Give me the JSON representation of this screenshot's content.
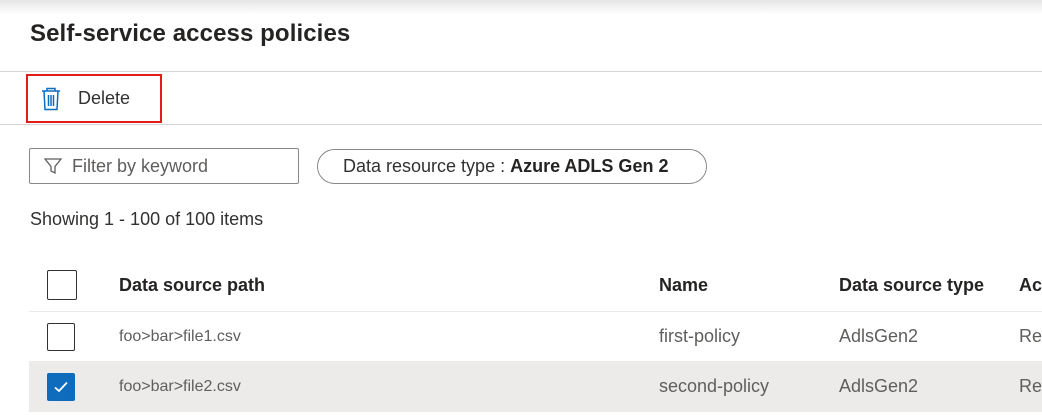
{
  "page": {
    "title": "Self-service access policies"
  },
  "toolbar": {
    "delete_label": "Delete",
    "delete_icon": "trash-icon"
  },
  "filter": {
    "placeholder": "Filter by keyword",
    "icon": "filter-icon"
  },
  "pill": {
    "key": "Data resource type :",
    "value": "Azure ADLS Gen 2"
  },
  "status": {
    "count_text": "Showing 1 - 100 of 100 items"
  },
  "table": {
    "columns": [
      "Data source path",
      "Name",
      "Data source type",
      "Ac"
    ],
    "rows": [
      {
        "path": "foo>bar>file1.csv",
        "name": "first-policy",
        "type": "AdlsGen2",
        "access": "Rea",
        "checked": false
      },
      {
        "path": "foo>bar>file2.csv",
        "name": "second-policy",
        "type": "AdlsGen2",
        "access": "Rea",
        "checked": true
      }
    ]
  },
  "colors": {
    "accent": "#0f6cbd",
    "highlight_border": "#e31b1b",
    "selected_row": "#edebe9"
  }
}
